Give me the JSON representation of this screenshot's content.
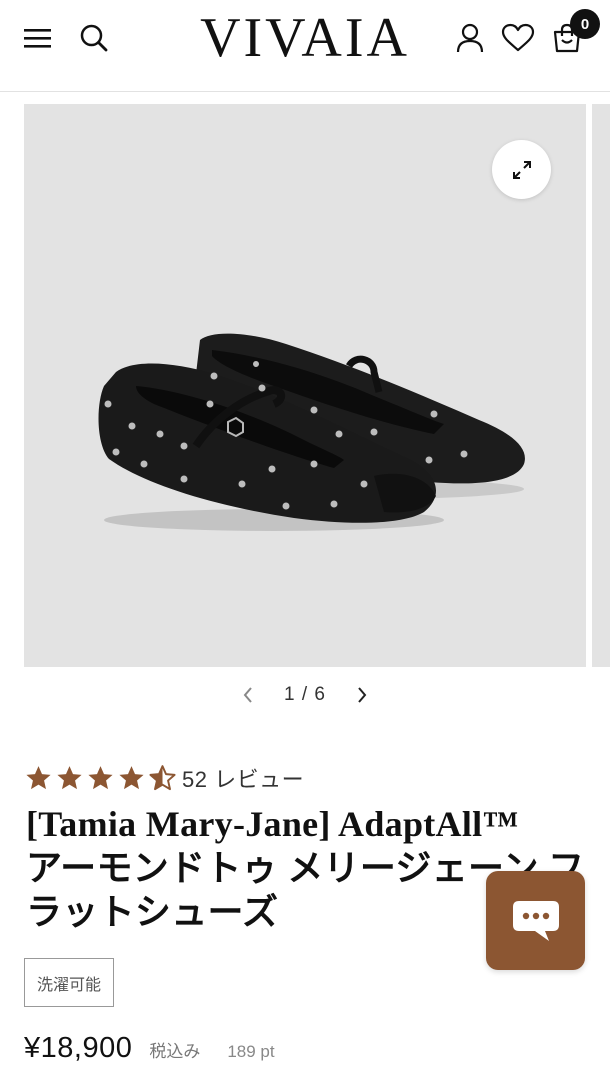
{
  "header": {
    "logo_text": "VIVAIA",
    "cart_count": "0",
    "icons": [
      "menu-icon",
      "search-icon",
      "account-icon",
      "heart-icon",
      "cart-icon"
    ]
  },
  "gallery": {
    "current": "1",
    "separator": "/",
    "total": "6",
    "pager_text": "1 / 6",
    "zoom_icon": "expand-icon",
    "background_color": "#e3e3e3"
  },
  "product": {
    "rating": 4.5,
    "rating_max": 5,
    "star_color": "#8c5632",
    "review_label": "52 レビュー",
    "title_lines": [
      "[Tamia Mary-Jane] AdaptAll™",
      "アーモンドトゥ メリージェーン フ",
      "ラットシューズ"
    ],
    "tag": "洗濯可能",
    "price": "¥18,900",
    "tax_label": "税込み",
    "points": "189 pt"
  },
  "chat": {
    "icon": "chat-bubble-icon",
    "color": "#8c5632"
  }
}
